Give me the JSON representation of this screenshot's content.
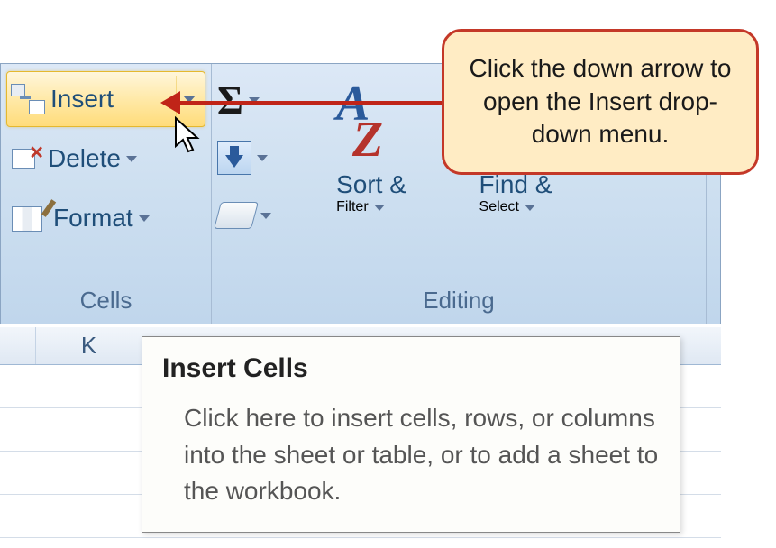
{
  "ribbon": {
    "cells": {
      "insert": "Insert",
      "delete": "Delete",
      "format": "Format",
      "groupLabel": "Cells"
    },
    "editing": {
      "sortFilter1": "Sort &",
      "sortFilter2": "Filter",
      "findSelect1": "Find &",
      "findSelect2": "Select",
      "groupLabel": "Editing"
    }
  },
  "worksheet": {
    "colK": "K"
  },
  "callout": {
    "text": "Click the down arrow to open the Insert drop-down menu."
  },
  "tooltip": {
    "title": "Insert Cells",
    "body": "Click here to insert cells, rows, or columns into the sheet or table, or to add a sheet to the workbook."
  }
}
